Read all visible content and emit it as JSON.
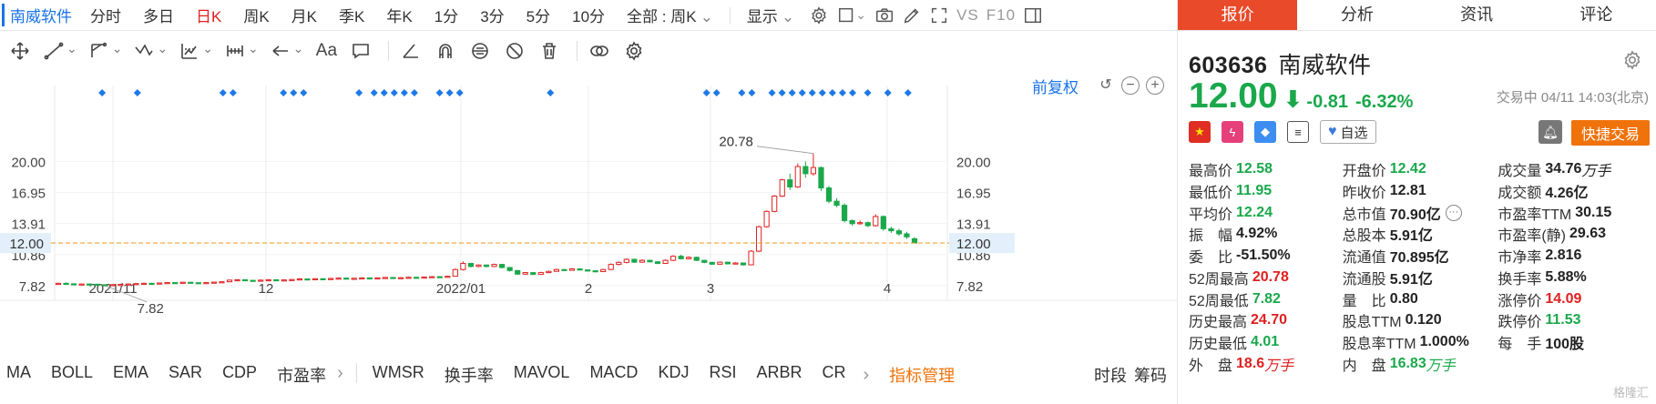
{
  "top_bar": {
    "stock_name": "南威软件",
    "periods": [
      {
        "label": "分时",
        "active": false
      },
      {
        "label": "多日",
        "active": false
      },
      {
        "label": "日K",
        "active": true
      },
      {
        "label": "周K",
        "active": false
      },
      {
        "label": "月K",
        "active": false
      },
      {
        "label": "季K",
        "active": false
      },
      {
        "label": "年K",
        "active": false
      },
      {
        "label": "1分",
        "active": false
      },
      {
        "label": "3分",
        "active": false
      },
      {
        "label": "5分",
        "active": false
      },
      {
        "label": "10分",
        "active": false
      }
    ],
    "range_select": "全部 : 周K",
    "display_select": "显示",
    "vs_label": "VS",
    "f10_label": "F10"
  },
  "draw_toolbar": {
    "text_tool": "Aa"
  },
  "chart": {
    "adjust_label": "前复权",
    "undo_glyph": "↺",
    "zoom_out_glyph": "−",
    "zoom_in_glyph": "+"
  },
  "chart_data": {
    "type": "candlestick",
    "y_ticks": [
      "20.00",
      "16.95",
      "13.91",
      "10.86",
      "7.82"
    ],
    "y_tick_values": [
      20.0,
      16.95,
      13.91,
      10.86,
      7.82
    ],
    "x_ticks": [
      "2021/11",
      "12",
      "2022/01",
      "2",
      "3",
      "4"
    ],
    "current_price_line": 12.0,
    "current_price_label": "12.00",
    "high_annotation": "20.78",
    "high_value": 20.78,
    "low_annotation": "7.82",
    "low_value": 7.82,
    "candles": [
      [
        8.02,
        8.05,
        8.1,
        7.95
      ],
      [
        8.05,
        8.0,
        8.12,
        7.96
      ],
      [
        8.0,
        7.94,
        8.05,
        7.9
      ],
      [
        7.94,
        7.98,
        8.03,
        7.9
      ],
      [
        7.98,
        7.96,
        8.04,
        7.92
      ],
      [
        7.96,
        7.91,
        8.0,
        7.86
      ],
      [
        7.91,
        7.86,
        7.95,
        7.82
      ],
      [
        7.86,
        7.92,
        7.97,
        7.84
      ],
      [
        7.92,
        7.94,
        8.0,
        7.88
      ],
      [
        7.94,
        7.98,
        8.04,
        7.9
      ],
      [
        7.98,
        8.02,
        8.08,
        7.94
      ],
      [
        8.02,
        8.05,
        8.12,
        7.98
      ],
      [
        8.05,
        8.03,
        8.1,
        7.98
      ],
      [
        8.03,
        8.08,
        8.14,
        8.0
      ],
      [
        8.08,
        8.12,
        8.18,
        8.04
      ],
      [
        8.12,
        8.1,
        8.16,
        8.05
      ],
      [
        8.1,
        8.15,
        8.2,
        8.06
      ],
      [
        8.15,
        8.11,
        8.19,
        8.07
      ],
      [
        8.11,
        8.08,
        8.14,
        8.03
      ],
      [
        8.08,
        8.12,
        8.18,
        8.04
      ],
      [
        8.12,
        8.16,
        8.22,
        8.08
      ],
      [
        8.16,
        8.2,
        8.26,
        8.12
      ],
      [
        8.2,
        8.36,
        8.42,
        8.18
      ],
      [
        8.36,
        8.4,
        8.46,
        8.3
      ],
      [
        8.4,
        8.34,
        8.44,
        8.28
      ],
      [
        8.34,
        8.3,
        8.38,
        8.24
      ],
      [
        8.3,
        8.36,
        8.42,
        8.26
      ],
      [
        8.36,
        8.4,
        8.46,
        8.32
      ],
      [
        8.4,
        8.32,
        8.44,
        8.28
      ],
      [
        8.32,
        8.38,
        8.44,
        8.28
      ],
      [
        8.38,
        8.42,
        8.48,
        8.34
      ],
      [
        8.42,
        8.48,
        8.55,
        8.38
      ],
      [
        8.48,
        8.44,
        8.52,
        8.4
      ],
      [
        8.44,
        8.5,
        8.56,
        8.4
      ],
      [
        8.5,
        8.46,
        8.54,
        8.42
      ],
      [
        8.46,
        8.52,
        8.58,
        8.42
      ],
      [
        8.52,
        8.56,
        8.62,
        8.48
      ],
      [
        8.56,
        8.5,
        8.6,
        8.46
      ],
      [
        8.5,
        8.54,
        8.6,
        8.46
      ],
      [
        8.54,
        8.58,
        8.64,
        8.5
      ],
      [
        8.58,
        8.52,
        8.62,
        8.48
      ],
      [
        8.52,
        8.58,
        8.64,
        8.48
      ],
      [
        8.58,
        8.62,
        8.68,
        8.54
      ],
      [
        8.62,
        8.56,
        8.66,
        8.52
      ],
      [
        8.56,
        8.6,
        8.66,
        8.52
      ],
      [
        8.6,
        8.64,
        8.7,
        8.56
      ],
      [
        8.64,
        8.6,
        8.68,
        8.56
      ],
      [
        8.6,
        8.66,
        8.72,
        8.56
      ],
      [
        8.66,
        8.7,
        8.76,
        8.62
      ],
      [
        8.7,
        8.68,
        8.76,
        8.62
      ],
      [
        8.68,
        8.74,
        8.8,
        8.64
      ],
      [
        8.74,
        9.4,
        9.5,
        8.7
      ],
      [
        9.4,
        10.0,
        10.2,
        9.3
      ],
      [
        10.0,
        9.7,
        10.06,
        9.6
      ],
      [
        9.7,
        9.84,
        9.92,
        9.62
      ],
      [
        9.84,
        9.7,
        9.9,
        9.6
      ],
      [
        9.7,
        9.9,
        9.98,
        9.64
      ],
      [
        9.9,
        9.6,
        9.94,
        9.5
      ],
      [
        9.6,
        9.3,
        9.64,
        9.2
      ],
      [
        9.3,
        8.95,
        9.36,
        8.86
      ],
      [
        8.95,
        9.1,
        9.16,
        8.9
      ],
      [
        9.1,
        8.92,
        9.14,
        8.86
      ],
      [
        8.92,
        9.1,
        9.18,
        8.88
      ],
      [
        9.1,
        9.22,
        9.3,
        9.04
      ],
      [
        9.22,
        9.4,
        9.48,
        9.18
      ],
      [
        9.4,
        9.32,
        9.46,
        9.26
      ],
      [
        9.32,
        9.46,
        9.54,
        9.28
      ],
      [
        9.46,
        9.36,
        9.52,
        9.3
      ],
      [
        9.36,
        9.28,
        9.4,
        9.22
      ],
      [
        9.28,
        9.2,
        9.32,
        9.14
      ],
      [
        9.2,
        9.4,
        9.48,
        9.16
      ],
      [
        9.4,
        9.9,
        10.0,
        9.36
      ],
      [
        9.9,
        10.1,
        10.2,
        9.8
      ],
      [
        10.1,
        10.4,
        10.5,
        10.0
      ],
      [
        10.4,
        10.12,
        10.46,
        10.04
      ],
      [
        10.12,
        10.3,
        10.4,
        10.06
      ],
      [
        10.3,
        10.16,
        10.36,
        10.08
      ],
      [
        10.16,
        10.0,
        10.22,
        9.92
      ],
      [
        10.0,
        10.3,
        10.4,
        9.96
      ],
      [
        10.3,
        10.7,
        10.8,
        10.22
      ],
      [
        10.7,
        10.46,
        10.84,
        10.38
      ],
      [
        10.46,
        10.6,
        10.7,
        10.38
      ],
      [
        10.6,
        10.3,
        10.66,
        10.22
      ],
      [
        10.3,
        10.1,
        10.36,
        10.02
      ],
      [
        10.1,
        9.92,
        10.16,
        9.84
      ],
      [
        9.92,
        10.12,
        10.2,
        9.88
      ],
      [
        10.12,
        9.96,
        10.18,
        9.9
      ],
      [
        9.96,
        10.04,
        10.12,
        9.9
      ],
      [
        10.04,
        9.86,
        10.1,
        9.78
      ],
      [
        9.86,
        11.2,
        11.3,
        9.82
      ],
      [
        11.2,
        13.6,
        13.7,
        11.1
      ],
      [
        13.6,
        15.1,
        15.2,
        13.5
      ],
      [
        15.1,
        16.6,
        16.7,
        15.0
      ],
      [
        16.6,
        18.2,
        18.3,
        16.5
      ],
      [
        18.2,
        17.5,
        18.8,
        17.2
      ],
      [
        17.5,
        19.5,
        19.8,
        17.4
      ],
      [
        19.5,
        18.8,
        20.0,
        18.4
      ],
      [
        18.8,
        19.4,
        20.78,
        18.6
      ],
      [
        19.4,
        17.4,
        19.5,
        17.1
      ],
      [
        17.4,
        16.1,
        17.6,
        15.9
      ],
      [
        16.1,
        15.7,
        16.4,
        15.5
      ],
      [
        15.7,
        14.2,
        15.9,
        14.0
      ],
      [
        14.2,
        13.9,
        14.3,
        13.7
      ],
      [
        13.9,
        14.0,
        14.2,
        13.8
      ],
      [
        14.0,
        13.7,
        14.1,
        13.56
      ],
      [
        13.7,
        14.6,
        14.8,
        13.6
      ],
      [
        14.6,
        13.4,
        14.7,
        13.2
      ],
      [
        13.4,
        13.2,
        13.6,
        13.0
      ],
      [
        13.2,
        12.9,
        13.4,
        12.7
      ],
      [
        12.9,
        12.6,
        13.1,
        12.4
      ],
      [
        12.42,
        12.0,
        12.58,
        11.95
      ]
    ],
    "signal_markers": [
      4,
      11,
      28,
      30,
      40,
      42,
      44,
      55,
      58,
      60,
      62,
      64,
      66,
      71,
      73,
      75,
      93,
      124,
      126,
      131,
      133,
      137,
      139,
      141,
      143,
      145,
      147,
      149,
      151,
      153,
      156,
      160,
      164
    ]
  },
  "indicators": {
    "items": [
      "MA",
      "BOLL",
      "EMA",
      "SAR",
      "CDP",
      "市盈率",
      "WMSR",
      "换手率",
      "MAVOL",
      "MACD",
      "KDJ",
      "RSI",
      "ARBR",
      "CR"
    ],
    "manage_label": "指标管理",
    "extra": [
      "时段",
      "筹码"
    ]
  },
  "quote_panel": {
    "tabs": [
      {
        "label": "报价",
        "active": true
      },
      {
        "label": "分析",
        "active": false
      },
      {
        "label": "资讯",
        "active": false
      },
      {
        "label": "评论",
        "active": false
      }
    ],
    "code": "603636",
    "name": "南威软件",
    "price": "12.00",
    "arrow": "⬇",
    "change": "-0.81",
    "change_pct": "-6.32%",
    "trade_time": "交易中 04/11 14:03(北京)",
    "watch_label": "自选",
    "quick_trade_label": "快捷交易",
    "stats": [
      [
        {
          "label": "最高价",
          "value": "12.58",
          "color": "g"
        },
        {
          "label": "开盘价",
          "value": "12.42",
          "color": "g"
        },
        {
          "label": "成交量",
          "value": "34.76",
          "unit": "万手",
          "color": "k"
        }
      ],
      [
        {
          "label": "最低价",
          "value": "11.95",
          "color": "g"
        },
        {
          "label": "昨收价",
          "value": "12.81",
          "color": "k"
        },
        {
          "label": "成交额",
          "value": "4.26亿",
          "color": "k"
        }
      ],
      [
        {
          "label": "平均价",
          "value": "12.24",
          "color": "g"
        },
        {
          "label": "总市值",
          "value": "70.90亿",
          "color": "k",
          "more": true
        },
        {
          "label": "市盈率TTM",
          "value": "30.15",
          "color": "k"
        }
      ],
      [
        {
          "label": "振　幅",
          "value": "4.92%",
          "color": "k"
        },
        {
          "label": "总股本",
          "value": "5.91亿",
          "color": "k"
        },
        {
          "label": "市盈率(静)",
          "value": "29.63",
          "color": "k"
        }
      ],
      [
        {
          "label": "委　比",
          "value": "-51.50%",
          "color": "k"
        },
        {
          "label": "流通值",
          "value": "70.895亿",
          "color": "k"
        },
        {
          "label": "市净率",
          "value": "2.816",
          "color": "k"
        }
      ],
      [
        {
          "label": "52周最高",
          "value": "20.78",
          "color": "r"
        },
        {
          "label": "流通股",
          "value": "5.91亿",
          "color": "k"
        },
        {
          "label": "换手率",
          "value": "5.88%",
          "color": "k"
        }
      ],
      [
        {
          "label": "52周最低",
          "value": "7.82",
          "color": "g"
        },
        {
          "label": "量　比",
          "value": "0.80",
          "color": "k"
        },
        {
          "label": "涨停价",
          "value": "14.09",
          "color": "r"
        }
      ],
      [
        {
          "label": "历史最高",
          "value": "24.70",
          "color": "r"
        },
        {
          "label": "股息TTM",
          "value": "0.120",
          "color": "k"
        },
        {
          "label": "跌停价",
          "value": "11.53",
          "color": "g"
        }
      ],
      [
        {
          "label": "历史最低",
          "value": "4.01",
          "color": "g"
        },
        {
          "label": "股息率TTM",
          "value": "1.000%",
          "color": "k"
        },
        {
          "label": "每　手",
          "value": "100股",
          "color": "k"
        }
      ],
      [
        {
          "label": "外　盘",
          "value": "18.6",
          "unit": "万手",
          "color": "r"
        },
        {
          "label": "内　盘",
          "value": "16.83",
          "unit": "万手",
          "color": "g"
        },
        {
          "label": "",
          "value": "",
          "color": "k"
        }
      ]
    ],
    "watermark": "格隆汇"
  },
  "colors": {
    "up": "#e02020",
    "down": "#1aa84b",
    "accent": "#1a73e8",
    "brand_orange": "#f0720a",
    "active_tab": "#e94a2a"
  }
}
